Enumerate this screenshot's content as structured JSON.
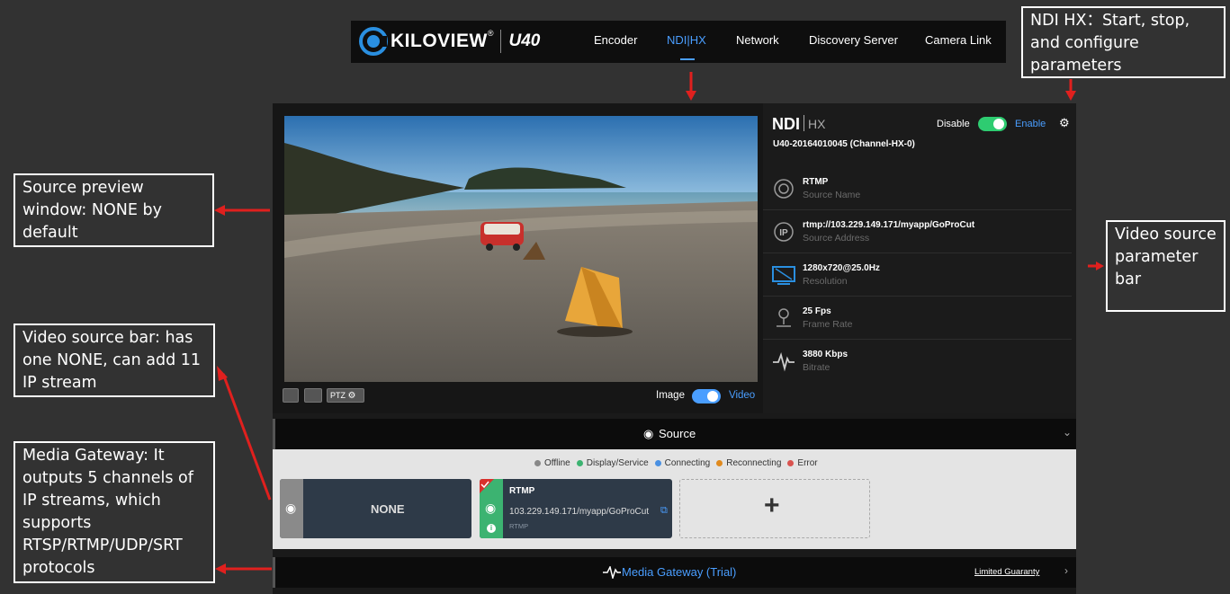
{
  "nav": {
    "logo_text": "KILOVIEW",
    "logo_reg": "®",
    "model": "U40",
    "items": [
      {
        "label": "Encoder"
      },
      {
        "label": "NDI|HX"
      },
      {
        "label": "Network"
      },
      {
        "label": "Discovery Server"
      },
      {
        "label": "Camera Link"
      }
    ]
  },
  "callouts": {
    "ndi": "NDI HX：Start, stop, and configure parameters",
    "preview": "Source preview window: NONE by default",
    "param_bar": "Video source parameter bar",
    "source_bar": "Video source bar: has one NONE, can add 11 IP stream",
    "gateway": "Media Gateway: It outputs 5 channels of IP streams, which supports RTSP/RTMP/UDP/SRT protocols"
  },
  "ndi_panel": {
    "logo_main": "NDI",
    "logo_sub": "HX",
    "device_name": "U40-20164010045 (Channel-HX-0)",
    "disable_label": "Disable",
    "enable_label": "Enable",
    "params": [
      {
        "icon": "source-name-icon",
        "value": "RTMP",
        "label": "Source Name"
      },
      {
        "icon": "ip-icon",
        "value": "rtmp://103.229.149.171/myapp/GoProCut",
        "label": "Source Address"
      },
      {
        "icon": "monitor-icon",
        "value": "1280x720@25.0Hz",
        "label": "Resolution"
      },
      {
        "icon": "camera-stand-icon",
        "value": "25 Fps",
        "label": "Frame Rate"
      },
      {
        "icon": "pulse-icon",
        "value": "3880 Kbps",
        "label": "Bitrate"
      }
    ]
  },
  "preview_controls": {
    "ptz_label": "PTZ",
    "image_label": "Image",
    "video_label": "Video"
  },
  "source_bar": {
    "title": "Source",
    "legend": [
      {
        "label": "Offline",
        "color": "#888888"
      },
      {
        "label": "Display/Service",
        "color": "#3cb371"
      },
      {
        "label": "Connecting",
        "color": "#4a90e2"
      },
      {
        "label": "Reconnecting",
        "color": "#e08a1e"
      },
      {
        "label": "Error",
        "color": "#d9534f"
      }
    ],
    "cards": [
      {
        "name": "NONE"
      },
      {
        "title": "RTMP",
        "address": "103.229.149.171/myapp/GoProCut",
        "protocol": "RTMP"
      }
    ],
    "add_label": "+"
  },
  "gateway_bar": {
    "title": "Media Gateway (Trial)",
    "link": "Limited Guaranty"
  },
  "colors": {
    "accent": "#4a9eff",
    "toggle_on": "#2ecc71",
    "callout_arrow": "#e0201e"
  }
}
